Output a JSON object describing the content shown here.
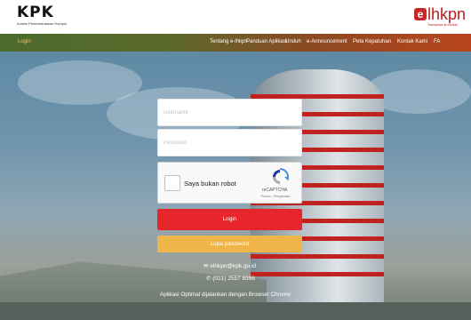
{
  "header": {
    "logo_text": "KPK",
    "logo_subtitle": "Komisi Pemberantasan Korupsi",
    "brand_text": "lhkpn",
    "brand_e": "e",
    "brand_tagline": "Transparan itu Mudah"
  },
  "nav": {
    "login": "Login",
    "items": [
      "Tentang e-lhkpn",
      "Panduan Aplikasi",
      "Unduh",
      "e-Announcement",
      "Peta Kepatuhan",
      "Kontak Kami",
      "FA"
    ]
  },
  "form": {
    "username_placeholder": "Username",
    "password_placeholder": "Password",
    "captcha_label": "Saya bukan robot",
    "captcha_brand": "reCAPTCHA",
    "captcha_links": "Privasi - Persyaratan",
    "login_button": "Login",
    "forgot_button": "Lupa password"
  },
  "contact": {
    "email": "elhkpn@kpk.go.id",
    "phone": "(021) 2557 8396",
    "optimal_note": "Aplikasi Optimal dijalankan dengan Browser Chrome"
  },
  "colors": {
    "login_button": "#e7262b",
    "forgot_button": "#efb548",
    "brand_red": "#c62828"
  },
  "icons": {
    "email": "envelope-icon",
    "phone": "phone-icon",
    "captcha": "recaptcha-icon"
  }
}
